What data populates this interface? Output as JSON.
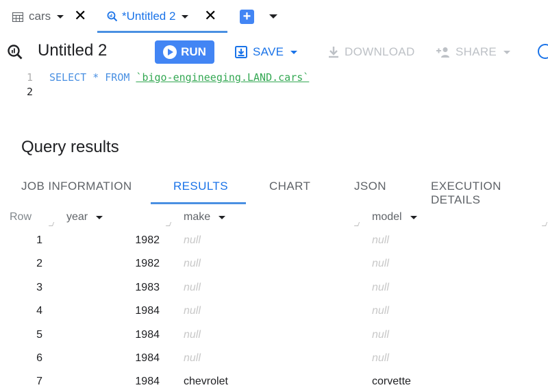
{
  "tabs": [
    {
      "label": "cars",
      "icon": "table-icon"
    },
    {
      "label": "*Untitled 2",
      "icon": "query-icon"
    }
  ],
  "editor": {
    "title": "Untitled 2",
    "toolbar": {
      "run": "RUN",
      "save": "SAVE",
      "download": "DOWNLOAD",
      "share": "SHARE"
    },
    "lines": [
      {
        "number": "1",
        "keywords": "SELECT * FROM ",
        "table": "`bigo-engineeging.LAND.cars`"
      },
      {
        "number": "2",
        "keywords": "",
        "table": ""
      }
    ]
  },
  "results": {
    "title": "Query results",
    "tabs": [
      "JOB INFORMATION",
      "RESULTS",
      "CHART",
      "JSON",
      "EXECUTION DETAILS"
    ],
    "active_tab": "RESULTS",
    "columns": {
      "row": "Row",
      "year": "year",
      "make": "make",
      "model": "model"
    },
    "rows": [
      {
        "row": "1",
        "year": "1982",
        "make": "null",
        "model": "null"
      },
      {
        "row": "2",
        "year": "1982",
        "make": "null",
        "model": "null"
      },
      {
        "row": "3",
        "year": "1983",
        "make": "null",
        "model": "null"
      },
      {
        "row": "4",
        "year": "1984",
        "make": "null",
        "model": "null"
      },
      {
        "row": "5",
        "year": "1984",
        "make": "null",
        "model": "null"
      },
      {
        "row": "6",
        "year": "1984",
        "make": "null",
        "model": "null"
      },
      {
        "row": "7",
        "year": "1984",
        "make": "chevrolet",
        "model": "corvette"
      }
    ]
  },
  "colors": {
    "accent": "#1a73e8",
    "run_button": "#4285f4",
    "sql_keyword": "#4a90e2",
    "table_ref": "#34a853",
    "null_text": "#c8c8c8",
    "disabled": "#bdc1c6"
  }
}
